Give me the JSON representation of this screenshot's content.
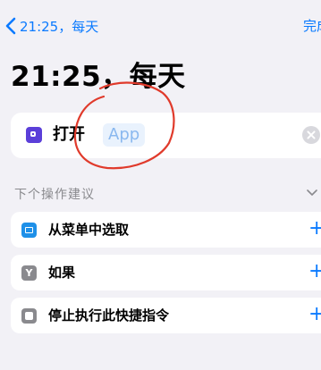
{
  "nav": {
    "back_label": "21:25，每天",
    "done_label": "完成"
  },
  "title": "21:25，每天",
  "action": {
    "verb": "打开",
    "param_placeholder": "App"
  },
  "suggestions": {
    "header": "下个操作建议",
    "items": [
      {
        "label": "从菜单中选取",
        "icon": "menu-select-icon",
        "add": "+"
      },
      {
        "label": "如果",
        "icon": "if-icon",
        "add": "+"
      },
      {
        "label": "停止执行此快捷指令",
        "icon": "stop-icon",
        "add": "+"
      }
    ]
  },
  "colors": {
    "accent": "#0a7aff",
    "background": "#f2f1f6",
    "annotation": "#e03a2b"
  }
}
